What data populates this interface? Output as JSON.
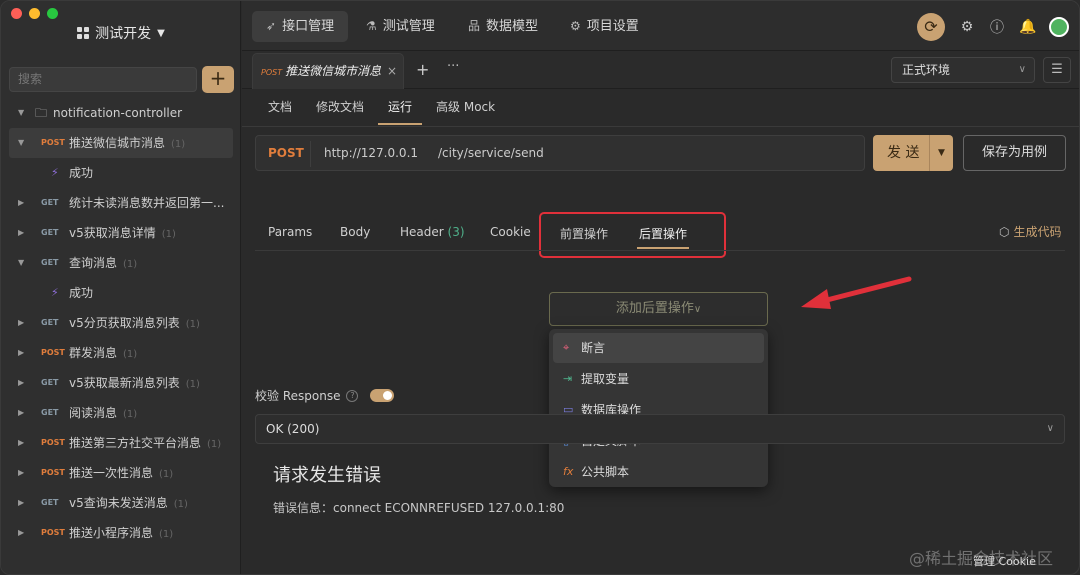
{
  "project": {
    "name": "测试开发"
  },
  "sidebar": {
    "search_placeholder": "搜索",
    "add_label": "+",
    "folder": "notification-controller",
    "items": [
      {
        "method": "POST",
        "name": "推送微信城市消息",
        "count": "(1)",
        "selected": true,
        "expanded": true
      },
      {
        "child": "成功"
      },
      {
        "method": "GET",
        "name": "统计未读消息数并返回第一..."
      },
      {
        "method": "GET",
        "name": "v5获取消息详情",
        "count": "(1)"
      },
      {
        "method": "GET",
        "name": "查询消息",
        "count": "(1)",
        "expanded": true
      },
      {
        "child": "成功"
      },
      {
        "method": "GET",
        "name": "v5分页获取消息列表",
        "count": "(1)"
      },
      {
        "method": "POST",
        "name": "群发消息",
        "count": "(1)"
      },
      {
        "method": "GET",
        "name": "v5获取最新消息列表",
        "count": "(1)"
      },
      {
        "method": "GET",
        "name": "阅读消息",
        "count": "(1)"
      },
      {
        "method": "POST",
        "name": "推送第三方社交平台消息",
        "count": "(1)"
      },
      {
        "method": "POST",
        "name": "推送一次性消息",
        "count": "(1)"
      },
      {
        "method": "GET",
        "name": "v5查询未发送消息",
        "count": "(1)"
      },
      {
        "method": "POST",
        "name": "推送小程序消息",
        "count": "(1)"
      }
    ]
  },
  "topnav": {
    "tabs": [
      "接口管理",
      "测试管理",
      "数据模型",
      "项目设置"
    ],
    "active": 0
  },
  "request_tab": {
    "method": "POST",
    "title": "推送微信城市消息",
    "close": "×",
    "plus": "+",
    "more": "···"
  },
  "environment": {
    "value": "正式环境"
  },
  "subtabs": {
    "items": [
      "文档",
      "修改文档",
      "运行",
      "高级 Mock"
    ],
    "active": 2
  },
  "request": {
    "method": "POST",
    "base_url": "http://127.0.0.1",
    "path": "/city/service/send",
    "send_label": "发 送",
    "save_label": "保存为用例"
  },
  "param_tabs": {
    "params": "Params",
    "body": "Body",
    "header": "Header",
    "header_count": "(3)",
    "cookie": "Cookie",
    "pre": "前置操作",
    "post": "后置操作",
    "gen_code": "生成代码"
  },
  "add_post_op": {
    "label": "添加后置操作",
    "caret": "∨"
  },
  "post_op_menu": [
    "断言",
    "提取变量",
    "数据库操作",
    "自定义脚本",
    "公共脚本"
  ],
  "response": {
    "verify_label": "校验 Response",
    "status": "OK (200)",
    "error_title": "请求发生错误",
    "error_message": "错误信息：connect ECONNREFUSED 127.0.0.1:80"
  },
  "footer": {
    "cookie": "管理 Cookie",
    "watermark": "@稀土掘金技术社区"
  },
  "colors": {
    "accent": "#c9a272",
    "post": "#e07d3c",
    "highlight_box": "#e0303a"
  }
}
